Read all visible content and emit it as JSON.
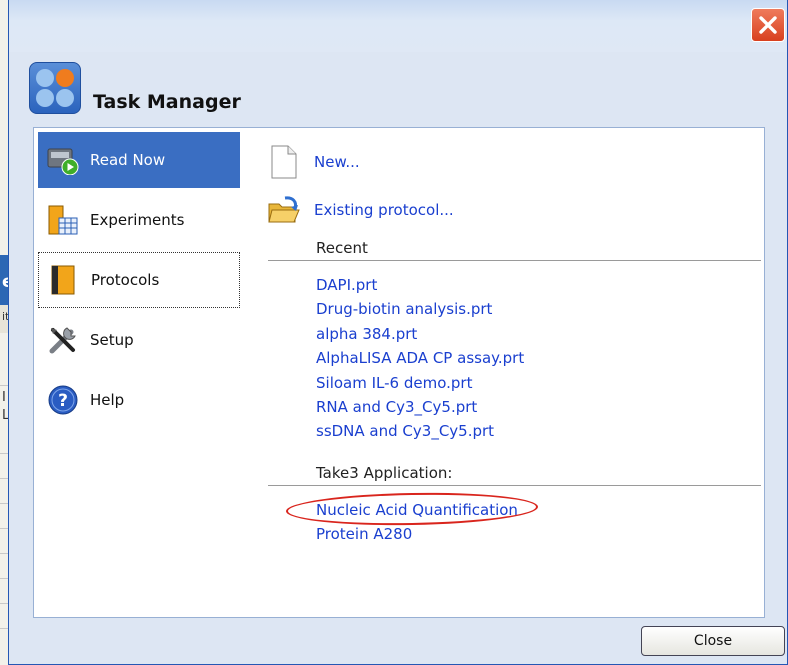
{
  "window": {
    "title": "Task Manager",
    "close_icon": "close-x-icon"
  },
  "background_app": {
    "glyphs": [
      "e",
      "it",
      "I",
      "L"
    ]
  },
  "sidebar": {
    "items": [
      {
        "label": "Read Now",
        "icon": "read-now-icon",
        "selected": true
      },
      {
        "label": "Experiments",
        "icon": "experiments-icon",
        "selected": false
      },
      {
        "label": "Protocols",
        "icon": "protocols-icon",
        "selected": false
      },
      {
        "label": "Setup",
        "icon": "setup-tools-icon",
        "selected": false
      },
      {
        "label": "Help",
        "icon": "help-icon",
        "selected": false
      }
    ]
  },
  "main": {
    "new_label": "New...",
    "existing_label": "Existing protocol...",
    "recent_heading": "Recent",
    "recent": [
      "DAPI.prt",
      "Drug-biotin analysis.prt",
      "alpha 384.prt",
      "AlphaLISA ADA CP assay.prt",
      "Siloam IL-6 demo.prt",
      "RNA and Cy3_Cy5.prt",
      "ssDNA and Cy3_Cy5.prt"
    ],
    "take3_heading": "Take3 Application:",
    "take3": [
      "Nucleic Acid Quantification",
      "Protein A280"
    ]
  },
  "footer": {
    "close_label": "Close"
  },
  "colors": {
    "accent": "#3a6ec2",
    "link": "#1a3fcf",
    "annotation": "#d9251d",
    "close_button": "#d8401f"
  }
}
